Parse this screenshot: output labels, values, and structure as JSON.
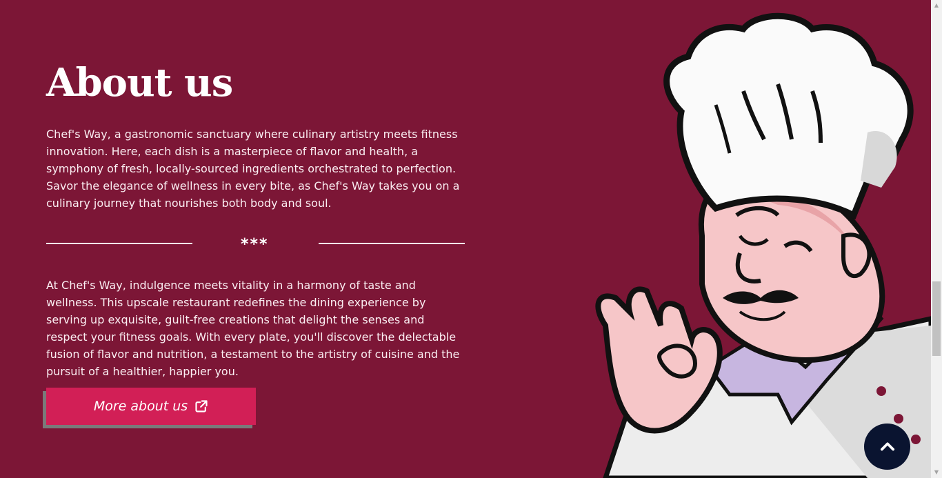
{
  "about": {
    "title": "About us",
    "paragraph1": "Chef's Way, a gastronomic sanctuary where culinary artistry meets fitness innovation. Here, each dish is a masterpiece of flavor and health, a symphony of fresh, locally-sourced ingredients orchestrated to perfection. Savor the elegance of wellness in every bite, as Chef's Way takes you on a culinary journey that nourishes both body and soul.",
    "divider_text": "***",
    "paragraph2": "At Chef's Way, indulgence meets vitality in a harmony of taste and wellness. This upscale restaurant redefines the dining experience by serving up exquisite, guilt-free creations that delight the senses and respect your fitness goals. With every plate, you'll discover the delectable fusion of flavor and nutrition, a testament to the artistry of cuisine and the pursuit of a healthier, happier you.",
    "button_label": "More about us"
  },
  "icons": {
    "button_icon": "external-link-icon",
    "back_to_top_icon": "chevron-up-icon"
  },
  "colors": {
    "background": "#7c1636",
    "button": "#d21f56",
    "back_to_top": "#0a1430"
  }
}
